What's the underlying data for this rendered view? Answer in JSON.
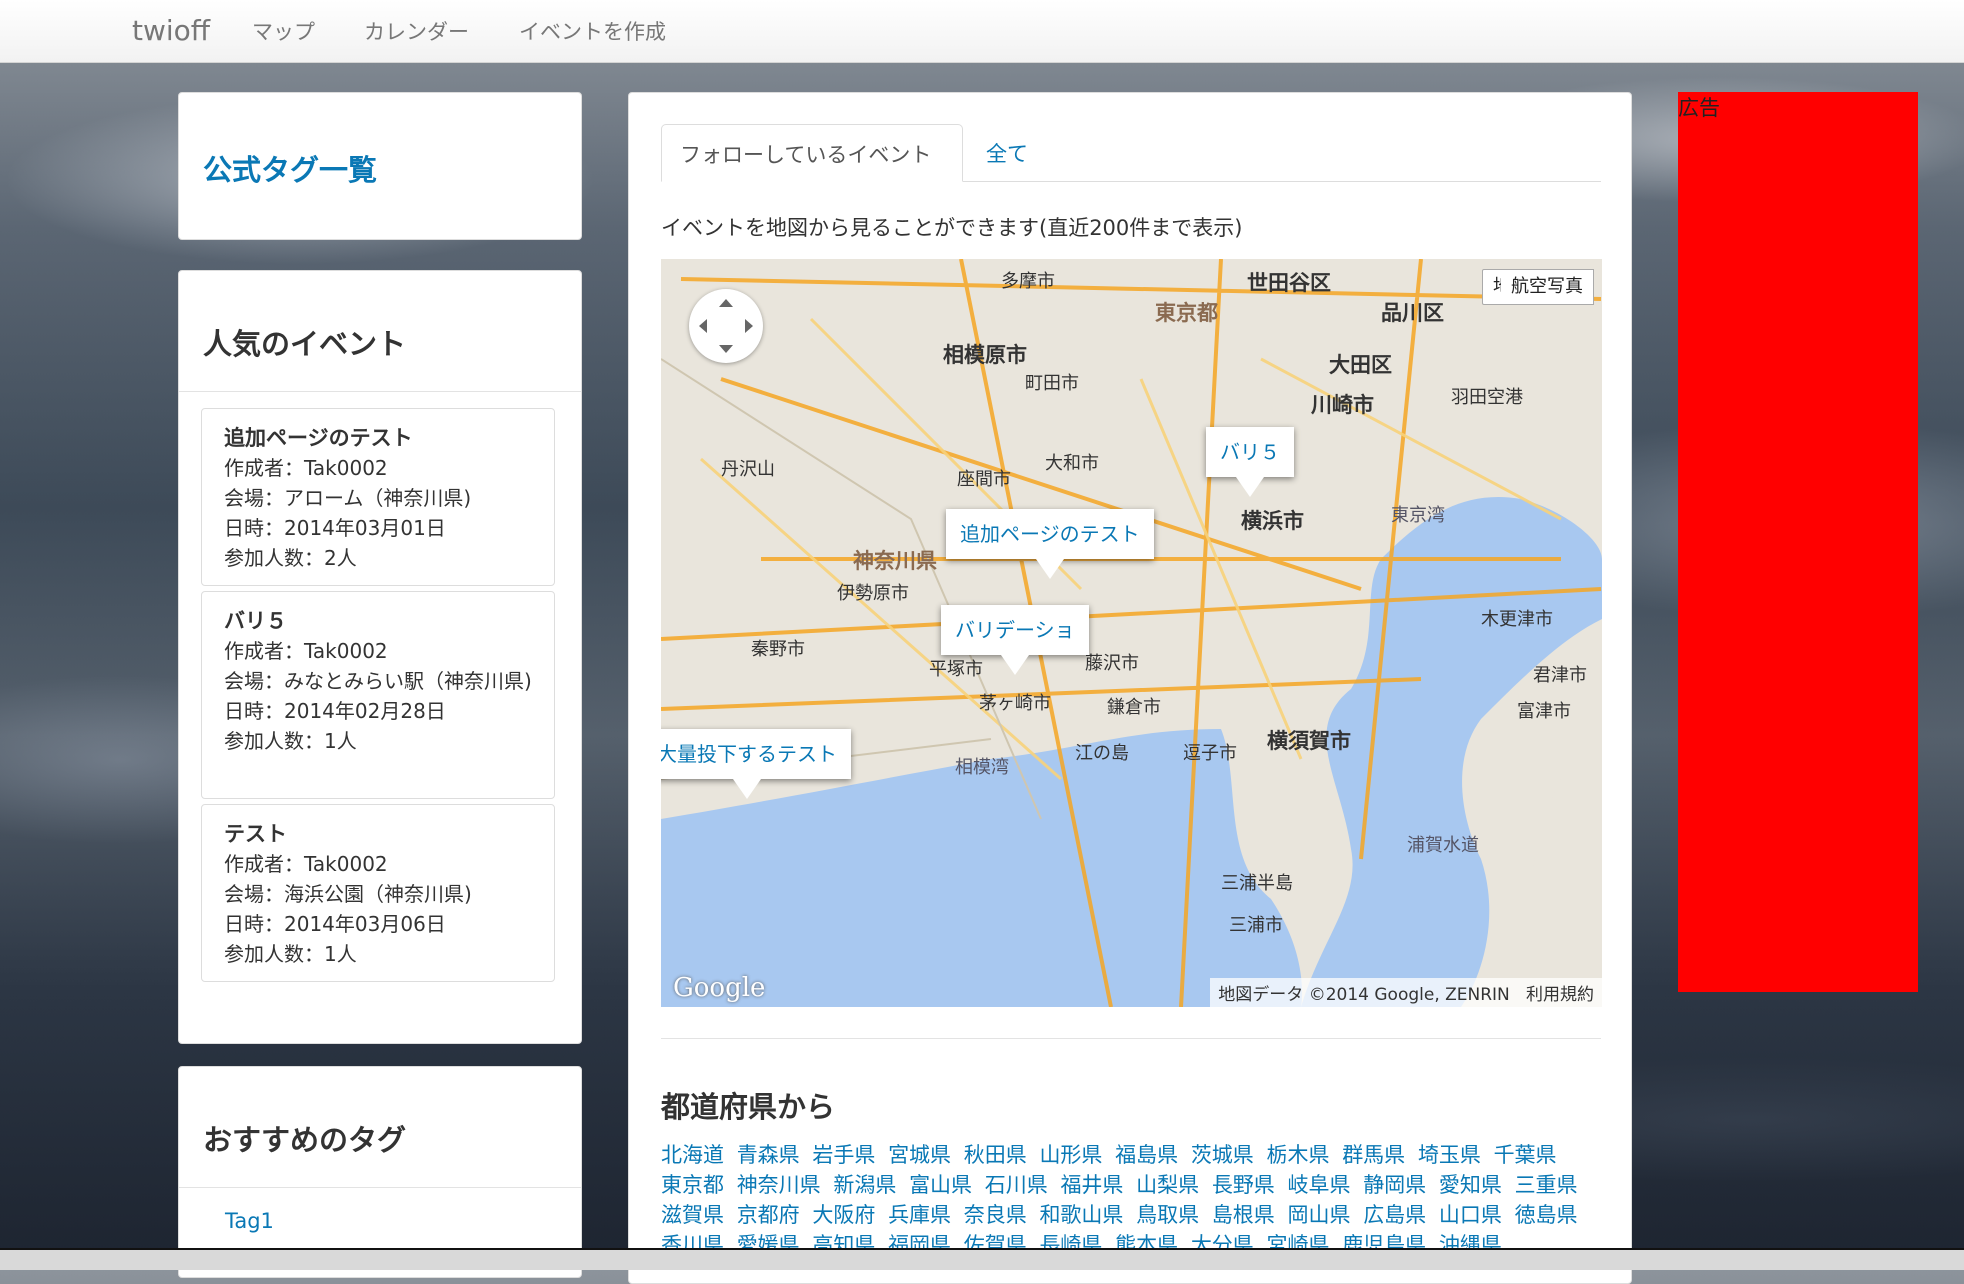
{
  "nav": {
    "brand": "twioff",
    "links": [
      "マップ",
      "カレンダー",
      "イベントを作成"
    ]
  },
  "sidebar": {
    "official_tags_title": "公式タグ一覧",
    "popular_title": "人気のイベント",
    "events": [
      {
        "title": "追加ページのテスト",
        "creator": "作成者：Tak0002",
        "venue": "会場：アローム（神奈川県)",
        "date": "日時：2014年03月01日",
        "participants": "参加人数：2人"
      },
      {
        "title": "バリ５",
        "creator": "作成者：Tak0002",
        "venue": "会場：みなとみらい駅（神奈川県)",
        "date": "日時：2014年02月28日",
        "participants": "参加人数：1人"
      },
      {
        "title": "テスト",
        "creator": "作成者：Tak0002",
        "venue": "会場：海浜公園（神奈川県)",
        "date": "日時：2014年03月06日",
        "participants": "参加人数：1人"
      }
    ],
    "recommended_title": "おすすめのタグ",
    "tags": [
      "Tag1"
    ]
  },
  "main": {
    "tabs": [
      {
        "label": "フォローしているイベント",
        "active": true
      },
      {
        "label": "全て",
        "active": false
      }
    ],
    "map_caption": "イベントを地図から見ることができます(直近200件まで表示)",
    "map": {
      "type_buttons": [
        "地図",
        "航空写真"
      ],
      "attribution": "地図データ ©2014 Google, ZENRIN",
      "terms": "利用規約",
      "logo": "Google",
      "markers": [
        "バリ５",
        "追加ページのテスト",
        "バリデーショ",
        "大量投下するテスト"
      ],
      "place_labels": [
        "世田谷区",
        "品川区",
        "大田区",
        "東京都",
        "相模原市",
        "町田市",
        "川崎市",
        "大和市",
        "座間市",
        "横浜市",
        "神奈川県",
        "伊勢原市",
        "秦野市",
        "平塚市",
        "茅ヶ崎市",
        "藤沢市",
        "鎌倉市",
        "逗子市",
        "横須賀市",
        "江の島",
        "相模湾",
        "三浦半島",
        "三浦市",
        "浦賀水道",
        "富津市",
        "君津市",
        "木更津市",
        "東京湾",
        "多摩市",
        "丹沢山",
        "羽田空港"
      ]
    },
    "prefecture_title": "都道府県から",
    "prefectures": [
      "北海道",
      "青森県",
      "岩手県",
      "宮城県",
      "秋田県",
      "山形県",
      "福島県",
      "茨城県",
      "栃木県",
      "群馬県",
      "埼玉県",
      "千葉県",
      "東京都",
      "神奈川県",
      "新潟県",
      "富山県",
      "石川県",
      "福井県",
      "山梨県",
      "長野県",
      "岐阜県",
      "静岡県",
      "愛知県",
      "三重県",
      "滋賀県",
      "京都府",
      "大阪府",
      "兵庫県",
      "奈良県",
      "和歌山県",
      "鳥取県",
      "島根県",
      "岡山県",
      "広島県",
      "山口県",
      "徳島県",
      "香川県",
      "愛媛県",
      "高知県",
      "福岡県",
      "佐賀県",
      "長崎県",
      "熊本県",
      "大分県",
      "宮崎県",
      "鹿児島県",
      "沖縄県"
    ]
  },
  "ad": {
    "label": "広告",
    "color": "#ff0000"
  },
  "colors": {
    "link": "#0a78b5",
    "sea": "#a8c8f0",
    "land": "#e9e5dc",
    "road": "#f5a623"
  }
}
